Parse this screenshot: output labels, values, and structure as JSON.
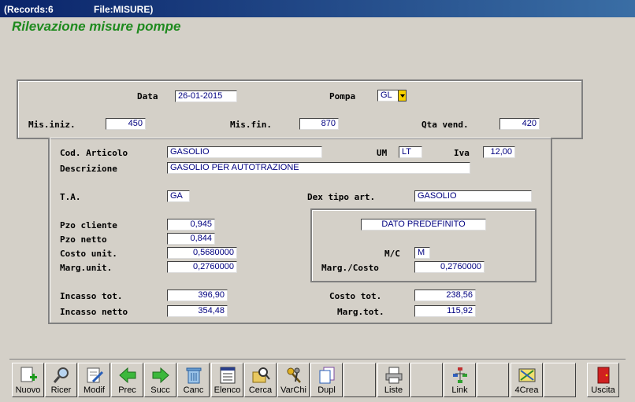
{
  "window": {
    "records": "(Records:6",
    "file": "File:MISURE)"
  },
  "app_title": "Rilevazione misure pompe",
  "header": {
    "data_label": "Data",
    "data_value": "26-01-2015",
    "pompa_label": "Pompa",
    "pompa_value": "GL",
    "mis_iniz_label": "Mis.iniz.",
    "mis_iniz_value": "450",
    "mis_fin_label": "Mis.fin.",
    "mis_fin_value": "870",
    "qta_vend_label": "Qta vend.",
    "qta_vend_value": "420"
  },
  "detail": {
    "cod_articolo_label": "Cod. Articolo",
    "cod_articolo_value": "GASOLIO",
    "um_label": "UM",
    "um_value": "LT",
    "iva_label": "Iva",
    "iva_value": "12,00",
    "descrizione_label": "Descrizione",
    "descrizione_value": "GASOLIO PER AUTOTRAZIONE",
    "ta_label": "T.A.",
    "ta_value": "GA",
    "dex_tipo_label": "Dex tipo art.",
    "dex_tipo_value": "GASOLIO",
    "pzo_cliente_label": "Pzo cliente",
    "pzo_cliente_value": "0,945",
    "pzo_netto_label": "Pzo netto",
    "pzo_netto_value": "0,844",
    "costo_unit_label": "Costo unit.",
    "costo_unit_value": "0,5680000",
    "marg_unit_label": "Marg.unit.",
    "marg_unit_value": "0,2760000",
    "dato_predefinito": "DATO PREDEFINITO",
    "mc_label": "M/C",
    "mc_value": "M",
    "marg_costo_label": "Marg./Costo",
    "marg_costo_value": "0,2760000",
    "incasso_tot_label": "Incasso tot.",
    "incasso_tot_value": "396,90",
    "incasso_netto_label": "Incasso netto",
    "incasso_netto_value": "354,48",
    "costo_tot_label": "Costo tot.",
    "costo_tot_value": "238,56",
    "marg_tot_label": "Marg.tot.",
    "marg_tot_value": "115,92"
  },
  "toolbar": {
    "nuovo": "Nuovo",
    "ricer": "Ricer",
    "modif": "Modif",
    "prec": "Prec",
    "succ": "Succ",
    "canc": "Canc",
    "elenco": "Elenco",
    "cerca": "Cerca",
    "varchi": "VarChi",
    "dupl": "Dupl",
    "liste": "Liste",
    "link": "Link",
    "crea4": "4Crea",
    "uscita": "Uscita"
  },
  "colors": {
    "title_green": "#1e8a1e",
    "value_blue": "#000080",
    "titlebar": "#0a246a"
  }
}
